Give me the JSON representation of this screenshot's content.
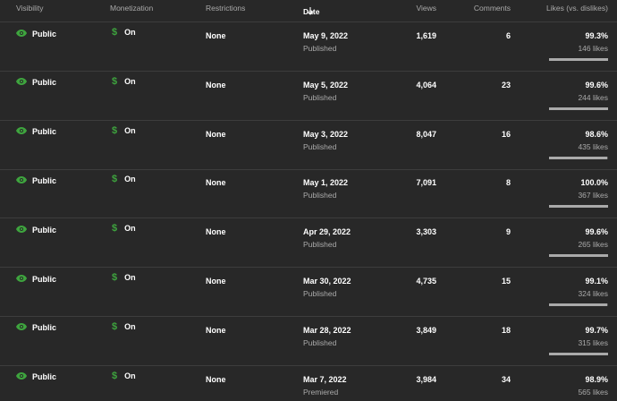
{
  "header": {
    "visibility": "Visibility",
    "monetization": "Monetization",
    "restrictions": "Restrictions",
    "date": "Date",
    "views": "Views",
    "comments": "Comments",
    "likes": "Likes (vs. dislikes)"
  },
  "icons": {
    "visibility": "eye-icon",
    "monetization": "dollar-icon",
    "sort": "arrow-down-icon"
  },
  "colors": {
    "accent_green": "#3ea43e",
    "background": "#282828"
  },
  "rows": [
    {
      "visibility": "Public",
      "monetization": "On",
      "restrictions": "None",
      "date": "May 9, 2022",
      "status": "Published",
      "views": "1,619",
      "comments": "6",
      "likes_pct": "99.3%",
      "likes_count": "146 likes",
      "ratio": 0.993
    },
    {
      "visibility": "Public",
      "monetization": "On",
      "restrictions": "None",
      "date": "May 5, 2022",
      "status": "Published",
      "views": "4,064",
      "comments": "23",
      "likes_pct": "99.6%",
      "likes_count": "244 likes",
      "ratio": 0.996
    },
    {
      "visibility": "Public",
      "monetization": "On",
      "restrictions": "None",
      "date": "May 3, 2022",
      "status": "Published",
      "views": "8,047",
      "comments": "16",
      "likes_pct": "98.6%",
      "likes_count": "435 likes",
      "ratio": 0.986
    },
    {
      "visibility": "Public",
      "monetization": "On",
      "restrictions": "None",
      "date": "May 1, 2022",
      "status": "Published",
      "views": "7,091",
      "comments": "8",
      "likes_pct": "100.0%",
      "likes_count": "367 likes",
      "ratio": 1.0
    },
    {
      "visibility": "Public",
      "monetization": "On",
      "restrictions": "None",
      "date": "Apr 29, 2022",
      "status": "Published",
      "views": "3,303",
      "comments": "9",
      "likes_pct": "99.6%",
      "likes_count": "265 likes",
      "ratio": 0.996
    },
    {
      "visibility": "Public",
      "monetization": "On",
      "restrictions": "None",
      "date": "Mar 30, 2022",
      "status": "Published",
      "views": "4,735",
      "comments": "15",
      "likes_pct": "99.1%",
      "likes_count": "324 likes",
      "ratio": 0.991
    },
    {
      "visibility": "Public",
      "monetization": "On",
      "restrictions": "None",
      "date": "Mar 28, 2022",
      "status": "Published",
      "views": "3,849",
      "comments": "18",
      "likes_pct": "99.7%",
      "likes_count": "315 likes",
      "ratio": 0.997
    },
    {
      "visibility": "Public",
      "monetization": "On",
      "restrictions": "None",
      "date": "Mar 7, 2022",
      "status": "Premiered",
      "views": "3,984",
      "comments": "34",
      "likes_pct": "98.9%",
      "likes_count": "565 likes",
      "ratio": 0.989
    }
  ]
}
